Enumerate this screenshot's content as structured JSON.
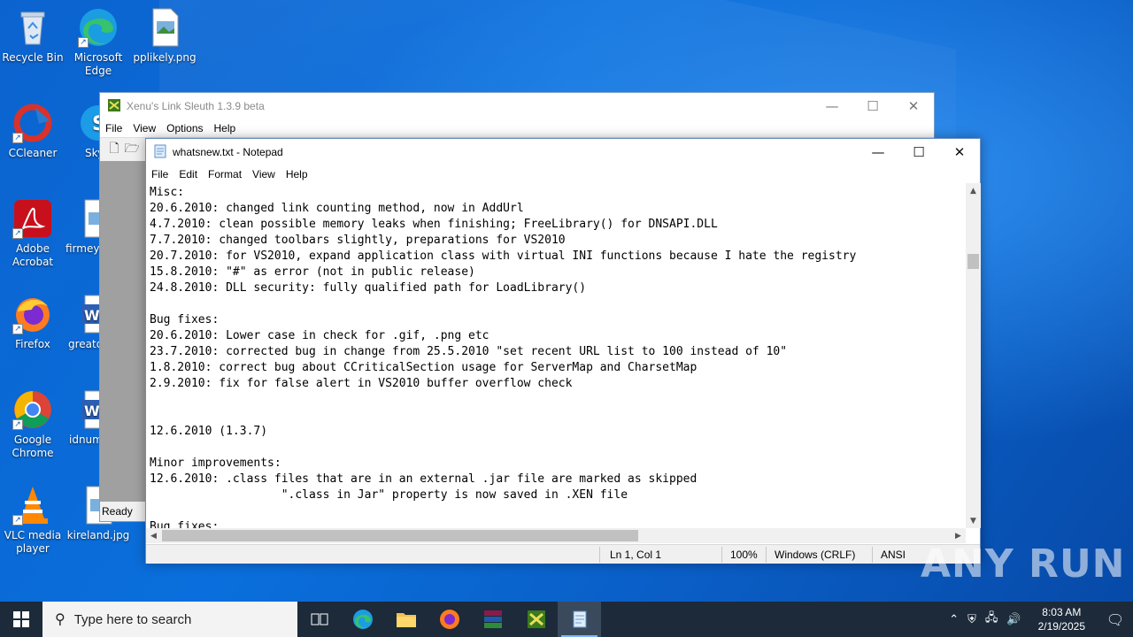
{
  "desktop": {
    "icons": [
      {
        "label": "Recycle Bin"
      },
      {
        "label": "Microsoft Edge"
      },
      {
        "label": "pplikely.png"
      },
      {
        "label": "CCleaner"
      },
      {
        "label": "Sky"
      },
      {
        "label": "Adobe Acrobat"
      },
      {
        "label": "firmey"
      },
      {
        "label": "Firefox"
      },
      {
        "label": "greatd"
      },
      {
        "label": "Google Chrome"
      },
      {
        "label": "idnum"
      },
      {
        "label": "VLC media player"
      },
      {
        "label": "kireland.jpg"
      }
    ]
  },
  "xenu": {
    "title": "Xenu's Link Sleuth 1.3.9 beta",
    "menu": [
      "File",
      "View",
      "Options",
      "Help"
    ],
    "status": "Ready"
  },
  "notepad": {
    "title": "whatsnew.txt - Notepad",
    "menu": [
      "File",
      "Edit",
      "Format",
      "View",
      "Help"
    ],
    "text": "Misc:\n20.6.2010: changed link counting method, now in AddUrl\n4.7.2010: clean possible memory leaks when finishing; FreeLibrary() for DNSAPI.DLL\n7.7.2010: changed toolbars slightly, preparations for VS2010\n20.7.2010: for VS2010, expand application class with virtual INI functions because I hate the registry\n15.8.2010: \"#\" as error (not in public release)\n24.8.2010: DLL security: fully qualified path for LoadLibrary()\n\nBug fixes:\n20.6.2010: Lower case in check for .gif, .png etc\n23.7.2010: corrected bug in change from 25.5.2010 \"set recent URL list to 100 instead of 10\"\n1.8.2010: correct bug about CCriticalSection usage for ServerMap and CharsetMap\n2.9.2010: fix for false alert in VS2010 buffer overflow check\n\n\n12.6.2010 (1.3.7)\n\nMinor improvements:\n12.6.2010: .class files that are in an external .jar file are marked as skipped\n                   \".class in Jar\" property is now saved in .XEN file\n\nBug fixes:",
    "status": {
      "position": "Ln 1, Col 1",
      "zoom": "100%",
      "line_ending": "Windows (CRLF)",
      "encoding": "ANSI"
    }
  },
  "watermark": "ANY RUN",
  "taskbar": {
    "search_placeholder": "Type here to search",
    "time": "8:03 AM",
    "date": "2/19/2025"
  }
}
